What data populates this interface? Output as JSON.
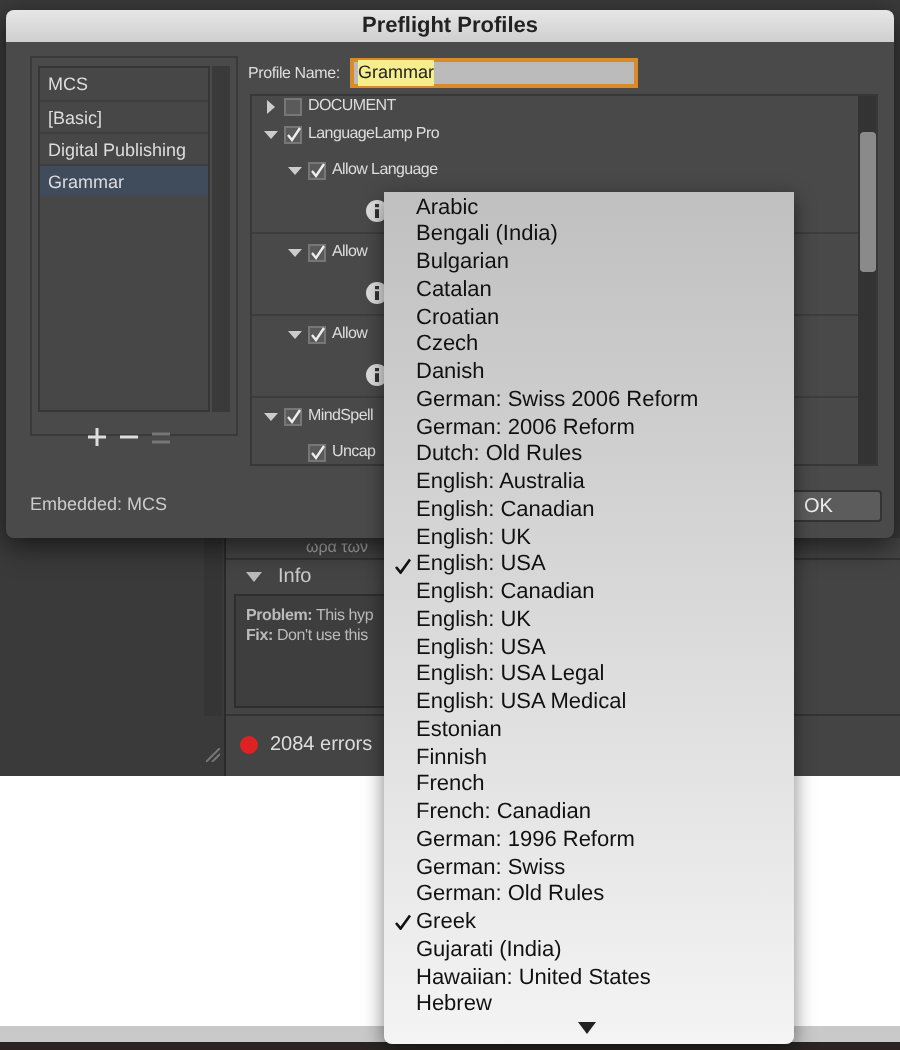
{
  "background_panel": {
    "row_text": "ωρα των",
    "info_header": "Info",
    "info_expanded": true,
    "info_lines": [
      "**Problem:** This hyp",
      "**Fix:** Don't use this"
    ],
    "status": "2084 errors"
  },
  "dialog": {
    "title": "Preflight Profiles",
    "profiles": [
      {
        "label": "MCS",
        "selected": false
      },
      {
        "label": "[Basic]",
        "selected": false
      },
      {
        "label": "Digital Publishing",
        "selected": false
      },
      {
        "label": "Grammar",
        "selected": true
      }
    ],
    "embedded": "Embedded: MCS",
    "profile_name_label": "Profile Name:",
    "profile_name_value": "Grammar",
    "tree": [
      {
        "kind": "rule",
        "label": "DOCUMENT",
        "expanded": false,
        "checked": false
      },
      {
        "kind": "rule",
        "label": "LanguageLamp Pro",
        "expanded": true,
        "checked": true,
        "children": [
          {
            "kind": "rule",
            "label": "Allow Language",
            "expanded": true,
            "checked": true,
            "children": [
              {
                "kind": "info"
              }
            ]
          },
          {
            "kind": "rule",
            "label": "Allow",
            "expanded": true,
            "checked": true,
            "children": [
              {
                "kind": "info"
              }
            ]
          },
          {
            "kind": "rule",
            "label": "Allow",
            "expanded": true,
            "checked": true,
            "children": [
              {
                "kind": "info"
              }
            ]
          }
        ]
      },
      {
        "kind": "rule",
        "label": "MindSpell",
        "expanded": true,
        "checked": true,
        "children": [
          {
            "kind": "rule",
            "label": "Uncap",
            "checked": true
          }
        ]
      }
    ],
    "ok_button": "OK"
  },
  "menu": {
    "items": [
      {
        "label": "Arabic",
        "checked": false
      },
      {
        "label": "Bengali (India)",
        "checked": false
      },
      {
        "label": "Bulgarian",
        "checked": false
      },
      {
        "label": "Catalan",
        "checked": false
      },
      {
        "label": "Croatian",
        "checked": false
      },
      {
        "label": "Czech",
        "checked": false
      },
      {
        "label": "Danish",
        "checked": false
      },
      {
        "label": "German: Swiss 2006 Reform",
        "checked": false
      },
      {
        "label": "German: 2006 Reform",
        "checked": false
      },
      {
        "label": "Dutch: Old Rules",
        "checked": false
      },
      {
        "label": "English: Australia",
        "checked": false
      },
      {
        "label": "English: Canadian",
        "checked": false
      },
      {
        "label": "English: UK",
        "checked": false
      },
      {
        "label": "English: USA",
        "checked": true
      },
      {
        "label": "English: Canadian",
        "checked": false
      },
      {
        "label": "English: UK",
        "checked": false
      },
      {
        "label": "English: USA",
        "checked": false
      },
      {
        "label": "English: USA Legal",
        "checked": false
      },
      {
        "label": "English: USA Medical",
        "checked": false
      },
      {
        "label": "Estonian",
        "checked": false
      },
      {
        "label": "Finnish",
        "checked": false
      },
      {
        "label": "French",
        "checked": false
      },
      {
        "label": "French: Canadian",
        "checked": false
      },
      {
        "label": "German: 1996 Reform",
        "checked": false
      },
      {
        "label": "German: Swiss",
        "checked": false
      },
      {
        "label": "German: Old Rules",
        "checked": false
      },
      {
        "label": "Greek",
        "checked": true
      },
      {
        "label": "Gujarati (India)",
        "checked": false
      },
      {
        "label": "Hawaiian: United States",
        "checked": false
      },
      {
        "label": "Hebrew",
        "checked": false
      }
    ]
  }
}
